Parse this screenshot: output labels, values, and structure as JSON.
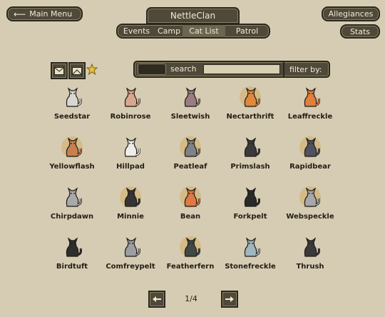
{
  "header": {
    "main_menu_label": "Main Menu",
    "clan_name": "NettleClan",
    "allegiances_label": "Allegiances",
    "stats_label": "Stats"
  },
  "tabs": [
    "Events",
    "Camp",
    "Cat List",
    "Patrol"
  ],
  "active_tab": "Cat List",
  "search": {
    "label": "search",
    "value": "",
    "filter_label": "filter by:"
  },
  "icons": {
    "main_menu": "left-arrow-icon",
    "view_1": "envelope-icon",
    "view_2": "envelope-open-icon",
    "favorite": "star-icon",
    "prev": "left-arrow-icon",
    "next": "right-arrow-icon"
  },
  "accent_colors": {
    "button_bg": "#4e4939",
    "background": "#d6ccb3",
    "highlight_disc": "#d3b679",
    "star": "#e8c33a"
  },
  "cats": [
    {
      "name": "Seedstar",
      "fur": "#d9d6d3",
      "highlight": false
    },
    {
      "name": "Robinrose",
      "fur": "#d9a78e",
      "highlight": false
    },
    {
      "name": "Sleetwish",
      "fur": "#9a7d82",
      "highlight": false
    },
    {
      "name": "Nectarthrift",
      "fur": "#e0883f",
      "highlight": true
    },
    {
      "name": "Leaffreckle",
      "fur": "#e0803c",
      "highlight": false
    },
    {
      "name": "Yellowflash",
      "fur": "#c88050",
      "highlight": true
    },
    {
      "name": "Hillpad",
      "fur": "#f0ede8",
      "highlight": false
    },
    {
      "name": "Peatleaf",
      "fur": "#7e8388",
      "highlight": true
    },
    {
      "name": "Primslash",
      "fur": "#3a3a3a",
      "highlight": false
    },
    {
      "name": "Rapidbear",
      "fur": "#4f5360",
      "highlight": true
    },
    {
      "name": "Chirpdawn",
      "fur": "#a7a9ab",
      "highlight": false
    },
    {
      "name": "Minnie",
      "fur": "#353535",
      "highlight": true
    },
    {
      "name": "Bean",
      "fur": "#e07a44",
      "highlight": true
    },
    {
      "name": "Forkpelt",
      "fur": "#2a2a2a",
      "highlight": false
    },
    {
      "name": "Webspeckle",
      "fur": "#a6a9ac",
      "highlight": true
    },
    {
      "name": "Birdtuft",
      "fur": "#2e2e2e",
      "highlight": false
    },
    {
      "name": "Comfreypelt",
      "fur": "#9c9ea1",
      "highlight": false
    },
    {
      "name": "Featherfern",
      "fur": "#3f4a44",
      "highlight": true
    },
    {
      "name": "Stonefreckle",
      "fur": "#9fb7bd",
      "highlight": false
    },
    {
      "name": "Thrush",
      "fur": "#3a3a3a",
      "highlight": false
    }
  ],
  "pagination": {
    "indicator": "1/4"
  }
}
